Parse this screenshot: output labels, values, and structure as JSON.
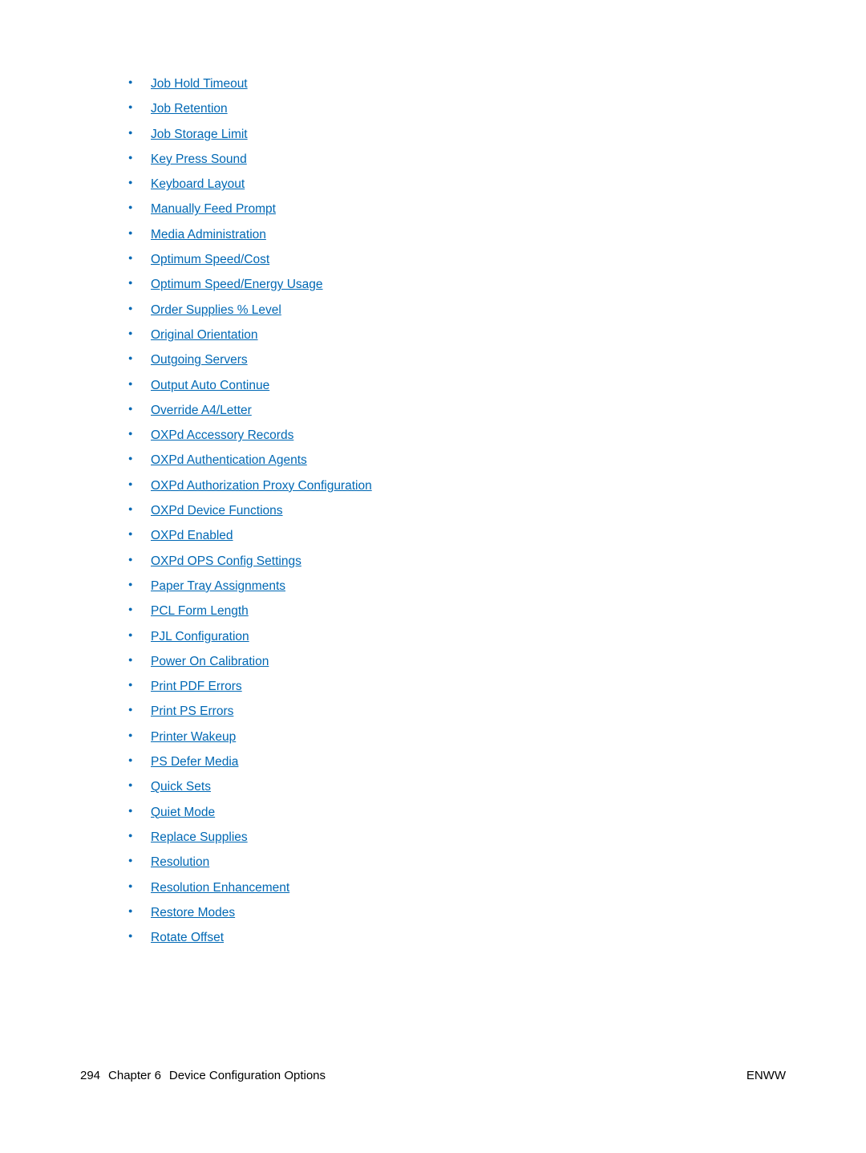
{
  "links": [
    "Job Hold Timeout",
    "Job Retention",
    "Job Storage Limit",
    "Key Press Sound",
    "Keyboard Layout",
    "Manually Feed Prompt",
    "Media Administration",
    "Optimum Speed/Cost",
    "Optimum Speed/Energy Usage",
    "Order Supplies % Level",
    "Original Orientation",
    "Outgoing Servers",
    "Output Auto Continue",
    "Override A4/Letter",
    "OXPd Accessory Records",
    "OXPd Authentication Agents",
    "OXPd Authorization Proxy Configuration",
    "OXPd Device Functions",
    "OXPd Enabled",
    "OXPd OPS Config Settings",
    "Paper Tray Assignments",
    "PCL Form Length",
    "PJL Configuration",
    "Power On Calibration",
    "Print PDF Errors",
    "Print PS Errors",
    "Printer Wakeup",
    "PS Defer Media",
    "Quick Sets",
    "Quiet Mode",
    "Replace Supplies",
    "Resolution",
    "Resolution Enhancement",
    "Restore Modes",
    "Rotate Offset"
  ],
  "footer": {
    "page_number": "294",
    "chapter_label": "Chapter 6",
    "chapter_title": "Device Configuration Options",
    "right": "ENWW"
  }
}
